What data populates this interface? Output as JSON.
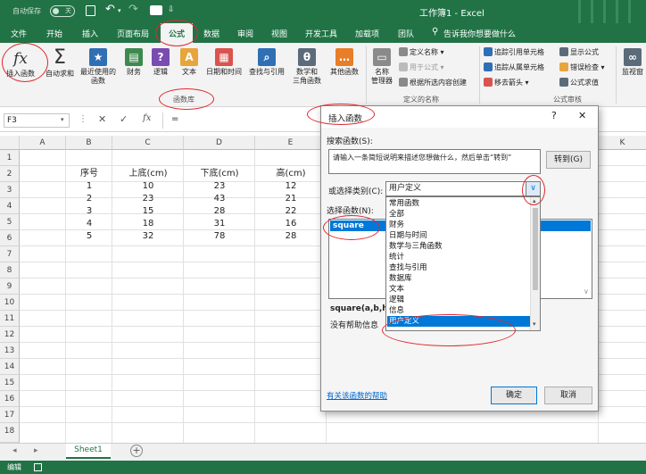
{
  "titlebar": {
    "autosave_label": "自动保存",
    "autosave_state": "关",
    "doc_title": "工作簿1 - Excel"
  },
  "tabs": [
    {
      "key": "file",
      "label": "文件"
    },
    {
      "key": "home",
      "label": "开始"
    },
    {
      "key": "insert",
      "label": "插入"
    },
    {
      "key": "layout",
      "label": "页面布局"
    },
    {
      "key": "formulas",
      "label": "公式"
    },
    {
      "key": "data",
      "label": "数据"
    },
    {
      "key": "review",
      "label": "审阅"
    },
    {
      "key": "view",
      "label": "视图"
    },
    {
      "key": "developer",
      "label": "开发工具"
    },
    {
      "key": "addins",
      "label": "加载项"
    },
    {
      "key": "team",
      "label": "团队"
    }
  ],
  "tellme": "告诉我你想要做什么",
  "ribbon": {
    "insert_function": "插入函数",
    "autosum": "自动求和",
    "recent_1": "最近使用的",
    "recent_2": "函数",
    "financial": "财务",
    "logical": "逻辑",
    "text": "文本",
    "datetime": "日期和时间",
    "lookup": "查找与引用",
    "math_1": "数学和",
    "math_2": "三角函数",
    "more": "其他函数",
    "group_library": "函数库",
    "name_manager_1": "名称",
    "name_manager_2": "管理器",
    "define_name": "定义名称",
    "use_in_formula": "用于公式",
    "create_from_selection": "根据所选内容创建",
    "group_names": "定义的名称",
    "trace_precedents": "追踪引用单元格",
    "trace_dependents": "追踪从属单元格",
    "remove_arrows": "移去箭头",
    "show_formulas": "显示公式",
    "error_checking": "错误检查",
    "evaluate_formula": "公式求值",
    "watch_1": "监视窗",
    "group_audit": "公式审核"
  },
  "formula_bar": {
    "name_box": "F3",
    "fx": "fx",
    "content": "="
  },
  "columns": [
    "A",
    "B",
    "C",
    "D",
    "E",
    "K"
  ],
  "rows": [
    "1",
    "2",
    "3",
    "4",
    "5",
    "6",
    "7",
    "8",
    "9",
    "10",
    "11",
    "12",
    "13",
    "14",
    "15",
    "16",
    "17",
    "18"
  ],
  "table": {
    "headers": [
      "序号",
      "上底(cm)",
      "下底(cm)",
      "高(cm)"
    ],
    "data": [
      [
        "1",
        "10",
        "23",
        "12"
      ],
      [
        "2",
        "23",
        "43",
        "21"
      ],
      [
        "3",
        "15",
        "28",
        "22"
      ],
      [
        "4",
        "18",
        "31",
        "16"
      ],
      [
        "5",
        "32",
        "78",
        "28"
      ]
    ]
  },
  "sheet_tab": "Sheet1",
  "status": {
    "mode": "编辑"
  },
  "dialog": {
    "title": "插入函数",
    "help_btn": "?",
    "close_btn": "✕",
    "search_label": "搜索函数(S):",
    "search_text": "请输入一条简短说明来描述您想做什么，然后单击“转到”",
    "goto_btn": "转到(G)",
    "category_label": "或选择类别(C):",
    "category_value": "用户定义",
    "select_label": "选择函数(N):",
    "functions": [
      "square"
    ],
    "signature": "square(a,b,h)",
    "no_help": "没有帮助信息",
    "help_link": "有关该函数的帮助",
    "ok_btn": "确定",
    "cancel_btn": "取消",
    "categories": [
      "常用函数",
      "全部",
      "财务",
      "日期与时间",
      "数学与三角函数",
      "统计",
      "查找与引用",
      "数据库",
      "文本",
      "逻辑",
      "信息",
      "用户定义"
    ],
    "selected_category_index": 11
  },
  "colors": {
    "excel_green": "#217346",
    "selection_blue": "#0078d7",
    "annotation_red": "#e0282e"
  }
}
